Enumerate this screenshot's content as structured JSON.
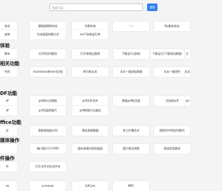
{
  "search": {
    "placeholder": "搜索内容...",
    "button": "搜索"
  },
  "rows": [
    [
      "协议",
      "超链接跳转协议",
      "谷歌失效",
      "----",
      "ftp服务协议",
      ""
    ],
    [
      "安装",
      "生成桌面快捷方式",
      "win7安装运行库",
      "",
      "",
      ""
    ],
    [
      "体验",
      "",
      "",
      "",
      "",
      ""
    ],
    [
      "脚本",
      "打开网页(随机)",
      "打开单独运营商",
      "下载运行(游戏)",
      "下载运行(下载测试数据)",
      "打"
    ],
    [
      "相关功能",
      "",
      "",
      "",
      "",
      ""
    ],
    [
      "代码",
      "markdown转word文档",
      "转为纯文本",
      "文本一键添加表格",
      "文本一键添色",
      "文本"
    ],
    [
      "DF功能",
      "",
      "",
      "",
      "",
      ""
    ],
    [
      "df",
      "pdf拆分页提取",
      "pdf文件合并",
      "提取pdf的页面",
      "文档转pdf",
      "pd"
    ],
    [
      "df",
      "pdf页面转图片",
      "pdf转图片压缩包",
      "",
      "",
      ""
    ],
    [
      "ffice功能",
      "",
      "",
      "",
      "",
      ""
    ],
    [
      "文",
      "获取表格部分列",
      "筛选表格数据",
      "多工作簿合并",
      "提取列中特定列数列",
      ""
    ],
    [
      "媒体操作",
      "",
      "",
      "",
      "",
      ""
    ],
    [
      "",
      "缩小图片尺寸900",
      "保存表格内容到桌面",
      "图片格式转换",
      "离线语音朗读",
      ""
    ],
    [
      "件操作",
      "",
      "",
      "",
      "",
      ""
    ],
    [
      "件",
      "打开文件对应文件夹",
      "",
      "",
      "",
      ""
    ],
    [
      "nk",
      "screener",
      "GifCam",
      "MPC",
      "",
      ""
    ]
  ]
}
